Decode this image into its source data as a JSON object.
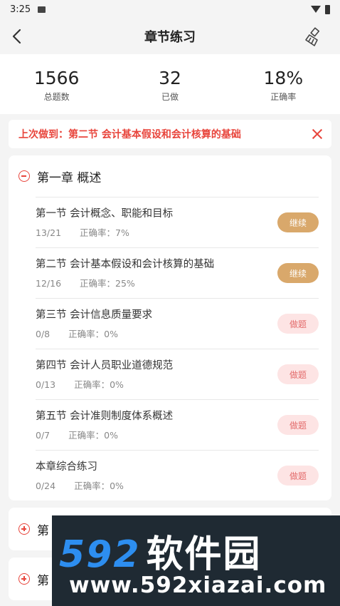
{
  "status": {
    "time": "3:25"
  },
  "nav": {
    "title": "章节练习"
  },
  "stats": [
    {
      "value": "1566",
      "label": "总题数"
    },
    {
      "value": "32",
      "label": "已做"
    },
    {
      "value": "18%",
      "label": "正确率"
    }
  ],
  "banner": {
    "text": "上次做到：第二节 会计基本假设和会计核算的基础"
  },
  "chapter1": {
    "name": "第一章 概述",
    "sections": [
      {
        "name": "第一节 会计概念、职能和目标",
        "progress": "13/21",
        "accuracy": "正确率：7%",
        "button": "继续"
      },
      {
        "name": "第二节 会计基本假设和会计核算的基础",
        "progress": "12/16",
        "accuracy": "正确率：25%",
        "button": "继续"
      },
      {
        "name": "第三节 会计信息质量要求",
        "progress": "0/8",
        "accuracy": "正确率：0%",
        "button": "做题"
      },
      {
        "name": "第四节 会计人员职业道德规范",
        "progress": "0/13",
        "accuracy": "正确率：0%",
        "button": "做题"
      },
      {
        "name": "第五节 会计准则制度体系概述",
        "progress": "0/7",
        "accuracy": "正确率：0%",
        "button": "做题"
      },
      {
        "name": "本章综合练习",
        "progress": "0/24",
        "accuracy": "正确率：0%",
        "button": "做题"
      }
    ]
  },
  "chapter2": {
    "name": "第"
  },
  "chapter3": {
    "name": "第"
  },
  "watermark": {
    "big": "592",
    "cn": "软件园",
    "url": "www.592xiazai.com"
  },
  "colors": {
    "accent": "#e8453c",
    "continue": "#d9a86b",
    "practice_bg": "#fde4e4"
  }
}
